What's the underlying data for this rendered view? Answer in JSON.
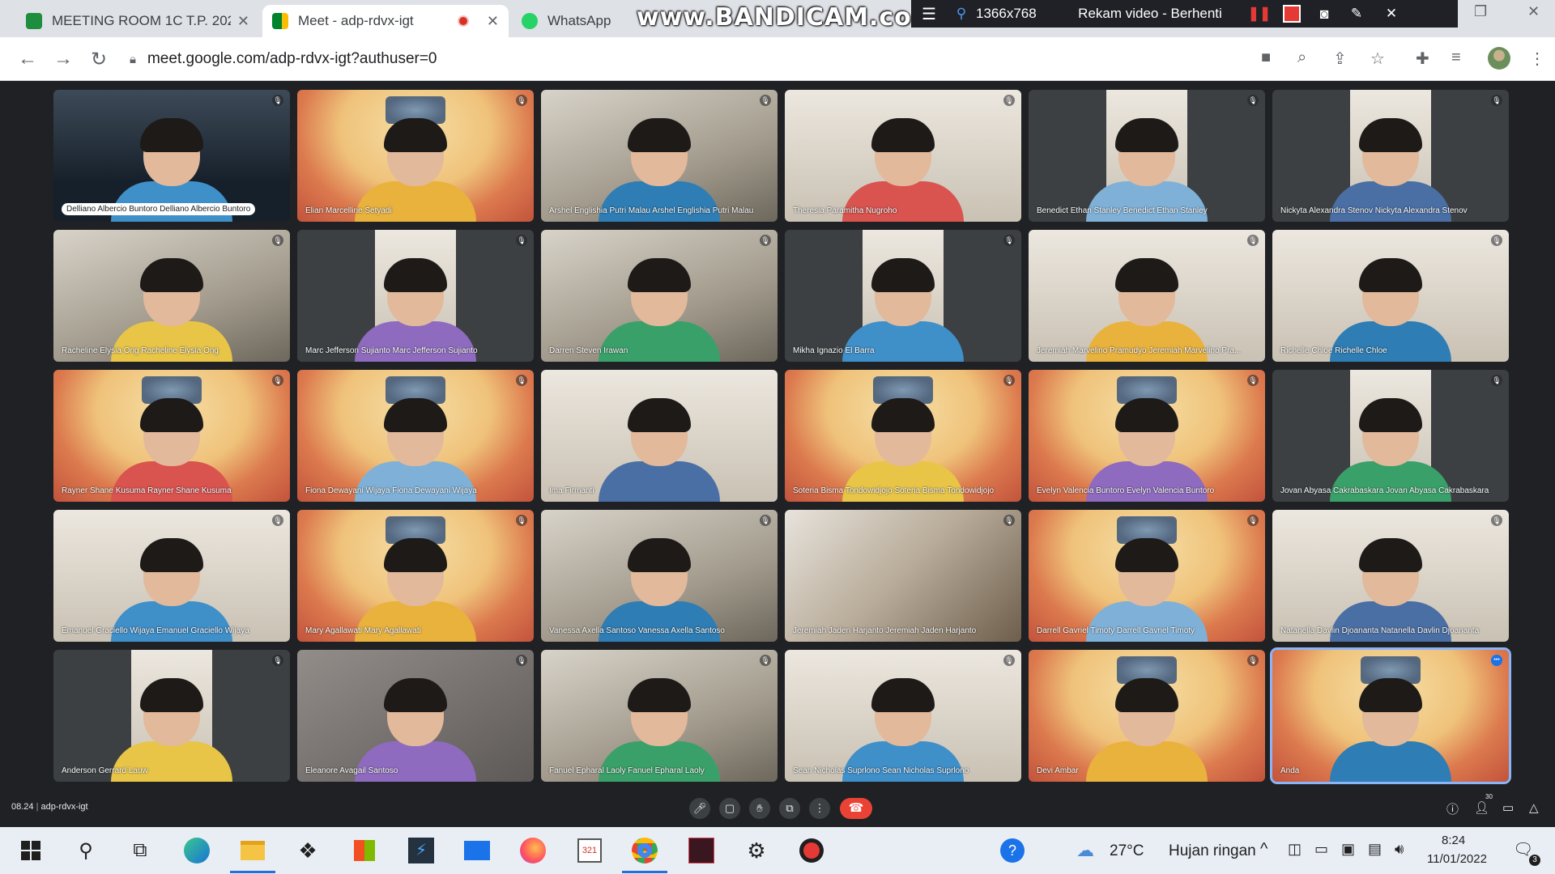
{
  "browser": {
    "tabs": [
      {
        "title": "MEETING ROOM 1C T.P. 202",
        "favicon_color": "#1e8e3e",
        "active": false
      },
      {
        "title": "Meet - adp-rdvx-igt",
        "favicon_color": "#00832d",
        "active": true
      },
      {
        "title": "WhatsApp",
        "favicon_color": "#25d366",
        "active": false
      }
    ],
    "url": "meet.google.com/adp-rdvx-igt?authuser=0"
  },
  "recorder": {
    "watermark": "www.BANDICAM.com",
    "resolution": "1366x768",
    "status": "Rekam video - Berhenti"
  },
  "meet": {
    "participants": [
      {
        "name": "Delliano Albercio Buntoro Delliano Albercio Buntoro",
        "video": "night",
        "label_style": "pill",
        "mute": "muted"
      },
      {
        "name": "Elian Marcelline Setyadi",
        "video": "poster",
        "mute": "muted"
      },
      {
        "name": "Arshel Englishia Putri Malau Arshel Englishia Putri Malau",
        "video": "room",
        "mute": "muted"
      },
      {
        "name": "Theresia Paramitha Nugroho",
        "video": "wall",
        "mute": "muted"
      },
      {
        "name": "Benedict Ethan Stanley Benedict Ethan Stanley",
        "video": "dark",
        "mute": "muted"
      },
      {
        "name": "Nickyta Alexandra Stenov Nickyta Alexandra Stenov",
        "video": "dark",
        "mute": "muted"
      },
      {
        "name": "Racheline Elysia Ong Racheline Elysia Ong",
        "video": "room",
        "mute": "muted"
      },
      {
        "name": "Marc Jefferson Sujianto Marc Jefferson Sujianto",
        "video": "dark",
        "mute": "muted"
      },
      {
        "name": "Darren Steven Irawan",
        "video": "room",
        "mute": "muted"
      },
      {
        "name": "Mikha Ignazio El Barra",
        "video": "dark",
        "mute": "muted"
      },
      {
        "name": "Jeremiah Marvelino Pramudyo Jeremiah Marvelino Pra...",
        "video": "wall",
        "mute": "muted"
      },
      {
        "name": "Richelle Chloe Richelle Chloe",
        "video": "wall",
        "mute": "muted"
      },
      {
        "name": "Rayner Shane Kusuma Rayner Shane Kusuma",
        "video": "poster",
        "mute": "muted"
      },
      {
        "name": "Fiona Dewayani Wijaya Fiona Dewayani Wijaya",
        "video": "poster",
        "mute": "muted"
      },
      {
        "name": "Ima Firmanti",
        "video": "wall",
        "mute": "none"
      },
      {
        "name": "Soteria Bisma Tondowidjojo Soteria Bisma Tondowidjojo",
        "video": "poster",
        "mute": "muted"
      },
      {
        "name": "Evelyn Valencia Buntoro Evelyn Valencia Buntoro",
        "video": "poster",
        "mute": "muted"
      },
      {
        "name": "Jovan Abyasa Cakrabaskara Jovan Abyasa Cakrabaskara",
        "video": "dark",
        "mute": "muted"
      },
      {
        "name": "Emanuel Graciello Wijaya Emanuel Graciello Wijaya",
        "video": "wall",
        "mute": "muted"
      },
      {
        "name": "Mary Agallawati Mary Agallawati",
        "video": "poster",
        "mute": "muted"
      },
      {
        "name": "Vanessa Axella Santoso Vanessa Axella Santoso",
        "video": "room",
        "mute": "muted"
      },
      {
        "name": "Jeremiah Jaden Harjanto Jeremiah Jaden Harjanto",
        "video": "blur",
        "mute": "muted"
      },
      {
        "name": "Darrell Gavriel Timoty Darrell Gavriel Timoty",
        "video": "poster",
        "mute": "muted"
      },
      {
        "name": "Natanella Davlin Djoananta Natanella Davlin Djoananta",
        "video": "wall",
        "mute": "muted"
      },
      {
        "name": "Anderson Gerrard Lauw",
        "video": "dark",
        "mute": "muted"
      },
      {
        "name": "Eleanore Avagail Santoso",
        "video": "mirror",
        "mute": "muted"
      },
      {
        "name": "Fanuel Epharal Laoly Fanuel Epharal Laoly",
        "video": "room",
        "mute": "muted"
      },
      {
        "name": "Sean Nicholas Suprlono Sean Nicholas Suprlono",
        "video": "wall",
        "mute": "muted"
      },
      {
        "name": "Devi Ambar",
        "video": "poster",
        "mute": "muted"
      },
      {
        "name": "Anda",
        "video": "poster",
        "mute": "speaking",
        "self": true
      }
    ],
    "bottom_bar": {
      "time": "08.24",
      "meeting_code": "adp-rdvx-igt",
      "participant_count": "30"
    }
  },
  "taskbar": {
    "weather_temp": "27°C",
    "weather_text": "Hujan ringan",
    "clock_time": "8:24",
    "clock_date": "11/01/2022",
    "notification_count": "3"
  }
}
